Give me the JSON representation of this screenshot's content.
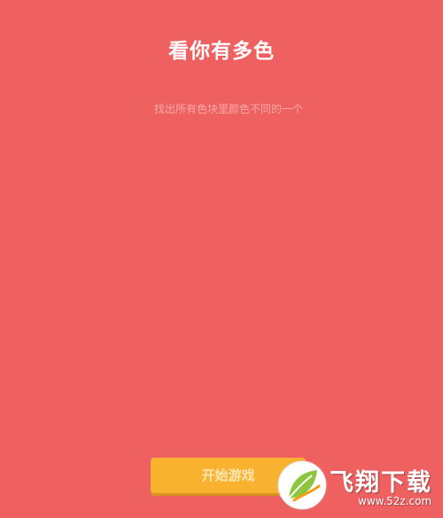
{
  "header": {
    "title": "看你有多色",
    "subtitle": "找出所有色块里颜色不同的一个"
  },
  "actions": {
    "start_label": "开始游戏"
  },
  "watermark": {
    "name": "飞翔下载",
    "url": "www.52z.com"
  },
  "colors": {
    "background": "#ef6161",
    "button": "#f8b230",
    "button_text": "#ffe6b3"
  }
}
